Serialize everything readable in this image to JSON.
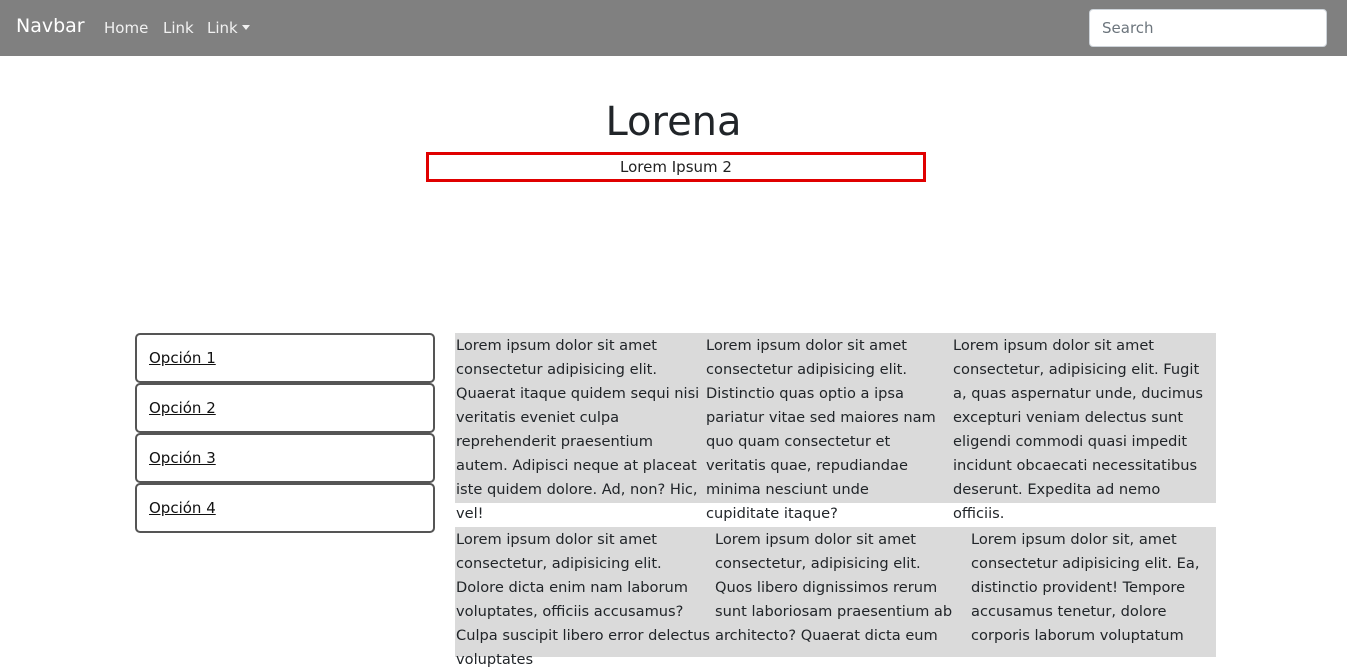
{
  "navbar": {
    "brand": "Navbar",
    "links": [
      "Home",
      "Link",
      "Link"
    ],
    "search_placeholder": "Search"
  },
  "header": {
    "title": "Lorena",
    "subtitle": "Lorem Ipsum 2"
  },
  "sidebar": {
    "options": [
      "Opción 1",
      "Opción 2",
      "Opción 3",
      "Opción 4"
    ]
  },
  "content": {
    "row1": [
      "Lorem ipsum dolor sit amet consectetur adipisicing elit. Quaerat itaque quidem sequi nisi veritatis eveniet culpa reprehenderit praesentium autem. Adipisci neque at placeat iste quidem dolore. Ad, non? Hic, vel!",
      "Lorem ipsum dolor sit amet consectetur adipisicing elit. Distinctio quas optio a ipsa pariatur vitae sed maiores nam quo quam consectetur et veritatis quae, repudiandae minima nesciunt unde cupiditate itaque?",
      "Lorem ipsum dolor sit amet consectetur, adipisicing elit. Fugit a, quas aspernatur unde, ducimus excepturi veniam delectus sunt eligendi commodi quasi impedit incidunt obcaecati necessitatibus deserunt. Expedita ad nemo officiis."
    ],
    "row2": [
      "Lorem ipsum dolor sit amet consectetur, adipisicing elit. Dolore dicta enim nam laborum voluptates, officiis accusamus? Culpa suscipit libero error delectus voluptates",
      "Lorem ipsum dolor sit amet consectetur, adipisicing elit. Quos libero dignissimos rerum sunt laboriosam praesentium ab architecto? Quaerat dicta eum",
      "Lorem ipsum dolor sit, amet consectetur adipisicing elit. Ea, distinctio provident! Tempore accusamus tenetur, dolore corporis laborum voluptatum"
    ]
  }
}
